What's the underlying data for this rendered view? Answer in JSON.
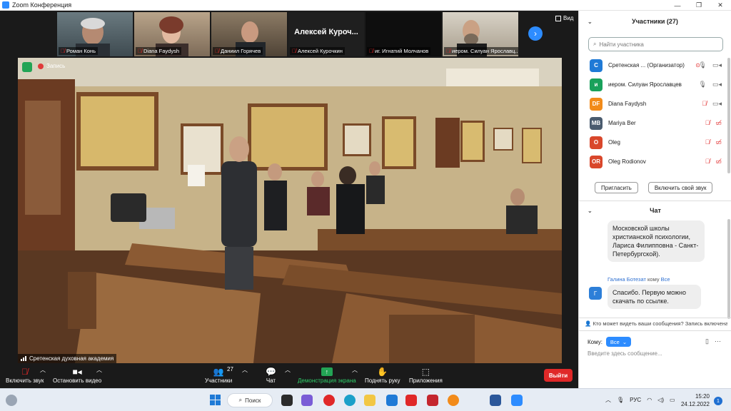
{
  "window": {
    "title": "Zoom Конференция"
  },
  "thumbnails": [
    {
      "name": "Роман Конь",
      "muted": true
    },
    {
      "name": "Diana Faydysh",
      "muted": true
    },
    {
      "name": "Даниил Горячев",
      "muted": true
    },
    {
      "name": "Алексей Курочкин",
      "muted": true,
      "display_name": "Алексей Куроч..."
    },
    {
      "name": "иг. Игнатий Молчанов",
      "muted": true
    },
    {
      "name": "иером. Силуан Ярославц...",
      "muted": true
    }
  ],
  "view_label": "Вид",
  "main_video": {
    "name": "Сретенская духовная академия",
    "rec_label": "Запись"
  },
  "toolbar": {
    "unmute": "Включить звук",
    "start_video": "Остановить видео",
    "participants": "Участники",
    "participants_count": "27",
    "chat": "Чат",
    "share": "Демонстрация экрана",
    "raise_hand": "Поднять руку",
    "apps": "Приложения",
    "leave": "Выйти"
  },
  "participants_panel": {
    "title": "Участники (27)",
    "search_placeholder": "Найти участника",
    "list": [
      {
        "initials": "С",
        "name": "Сретенская ...  (Организатор)",
        "color": "#1f7ad6",
        "mic": "on",
        "video": "on"
      },
      {
        "initials": "и",
        "name": "иером. Силуан Ярославцев",
        "color": "#19a15b",
        "mic": "on",
        "video": "on"
      },
      {
        "initials": "DF",
        "name": "Diana Faydysh",
        "color": "#f28b1a",
        "mic": "off",
        "video": "on"
      },
      {
        "initials": "MB",
        "name": "Mariya Ber",
        "color": "#4a5b6e",
        "mic": "off",
        "video": "off"
      },
      {
        "initials": "O",
        "name": "Oleg",
        "color": "#d9472b",
        "mic": "off",
        "video": "off"
      },
      {
        "initials": "OR",
        "name": "Oleg Rodionov",
        "color": "#d9472b",
        "mic": "off",
        "video": "off"
      }
    ],
    "invite": "Пригласить",
    "unmute_me": "Включить свой звук"
  },
  "chat_panel": {
    "title": "Чат",
    "message1": "Московской школы христианской психологии, Лариса Филипповна - Санкт-Петербургской).",
    "sender_name": "Галина Ботезат",
    "sender_to": "кому",
    "sender_target": "Все",
    "sender_initial": "Г",
    "message2": "Спасибо. Первую можно скачать по ссылке.",
    "who_sees": "Кто может видеть ваши сообщения? Запись включена",
    "to_label": "Кому:",
    "to_value": "Все",
    "input_placeholder": "Введите здесь сообщение..."
  },
  "taskbar": {
    "search": "Поиск",
    "lang": "РУС",
    "time": "15:20",
    "date": "24.12.2022",
    "notif_count": "1"
  }
}
